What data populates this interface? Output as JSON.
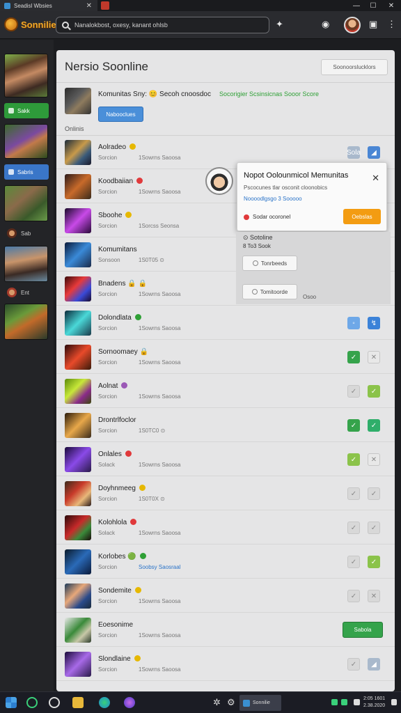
{
  "window": {
    "tab_title": "Seadisl Wbsies",
    "tab_close": "✕",
    "minimize": "—",
    "maximize": "☐",
    "close": "✕"
  },
  "app": {
    "brand": "Sonnilie",
    "search_value": "Nanalokbost, oxesy, kanant ohlsb"
  },
  "rail": {
    "buttons": [
      {
        "label": "Sakk",
        "color": "#2e9a3a"
      },
      {
        "label": "Sabris",
        "color": "#3a76c8"
      }
    ],
    "small_items": [
      {
        "label": "Sab"
      },
      {
        "label": "Ent"
      }
    ]
  },
  "panel": {
    "title": "Nersio Soonline",
    "header_button": "Soonoorslucklors",
    "community_label": "Komunitas Sny: 😊 Secoh cnoosdoc",
    "community_status": "Socorigier Scsinsicnas Sooor Score",
    "community_button": "Nabooclues",
    "online_label": "Onlinis"
  },
  "rows": [
    {
      "name": "Aolradeo",
      "badge": "#e6b800",
      "sub1": "Sorcion",
      "sub2": "1Sowrns Saoosa",
      "c1": "#a9b9cc",
      "c2": "#4a86d4",
      "c1g": "Sola",
      "c2g": "◢"
    },
    {
      "name": "Koodbaiian",
      "badge": "#e0393b",
      "sub1": "Sorcion",
      "sub2": "1Sowrns Saoosa",
      "c1": "",
      "c2": "",
      "c1g": "",
      "c2g": ""
    },
    {
      "name": "Sboohe",
      "badge": "#e6b800",
      "sub1": "Sorcion",
      "sub2": "1Sorcss Seonsa",
      "c1": "",
      "c2": "",
      "c1g": "",
      "c2g": ""
    },
    {
      "name": "Komumitans",
      "badge": "",
      "sub1": "Sonsoon",
      "sub2": "1S0T05 ⊙",
      "c1": "#3b82d8",
      "c2": "#3b82d8",
      "c1g": "↙",
      "c2g": "↯"
    },
    {
      "name": "Bnadens 🔒 🔒",
      "badge": "",
      "sub1": "Sorcion",
      "sub2": "1Sowrns Saoosa",
      "c1": "#e8e8e8",
      "c2": "#35a34b",
      "c1g": "✕",
      "c2g": "✓"
    },
    {
      "name": "Dolondlata",
      "badge": "#2fa036",
      "sub1": "Sorcion",
      "sub2": "1Sowrns Saoosa",
      "c1": "#6ea8e8",
      "c2": "#3b82d8",
      "c1g": "◦",
      "c2g": "↯"
    },
    {
      "name": "Sornoomaey 🔒",
      "badge": "",
      "sub1": "Sorcion",
      "sub2": "1Sowrns Saoosa",
      "c1": "#35a34b",
      "c2": "#e8e8e8",
      "c1g": "✓",
      "c2g": "✕"
    },
    {
      "name": "Aolnat",
      "badge": "#9b59b6",
      "sub1": "Sorcion",
      "sub2": "1Sowrns Saoosa",
      "c1": "#d8d8d8",
      "c2": "#8bc34a",
      "c1g": "✓",
      "c2g": "✓"
    },
    {
      "name": "Drontrlfoclor",
      "badge": "",
      "sub1": "Sorcion",
      "sub2": "1S0TC0 ⊙",
      "c1": "#35a34b",
      "c2": "#2fae6a",
      "c1g": "✓",
      "c2g": "✓"
    },
    {
      "name": "Onlales",
      "badge": "#e0393b",
      "sub1": "Solack",
      "sub2": "1Sowrns Saoosa",
      "c1": "#8bc34a",
      "c2": "#e8e8e8",
      "c1g": "✓",
      "c2g": "✕"
    },
    {
      "name": "Doyhnmeeg",
      "badge": "#e6b800",
      "sub1": "Sorcion",
      "sub2": "1S0T0X ⊙",
      "c1": "#d8d8d8",
      "c2": "#d8d8d8",
      "c1g": "✓",
      "c2g": "✓"
    },
    {
      "name": "Kolohlola",
      "badge": "#e0393b",
      "sub1": "Solack",
      "sub2": "1Sowrns Saoosa",
      "c1": "#d8d8d8",
      "c2": "#d8d8d8",
      "c1g": "✓",
      "c2g": "✓"
    },
    {
      "name": "Korlobes 🟢",
      "badge": "#2fa036",
      "sub1": "Sorcion",
      "sub2": "Soobsy Saosraal",
      "c1": "#d8d8d8",
      "c2": "#8bc34a",
      "c1g": "✓",
      "c2g": "✓"
    },
    {
      "name": "Sondemite",
      "badge": "#e6b800",
      "sub1": "Sorcion",
      "sub2": "1Sowrns Saoosa",
      "c1": "#d8d8d8",
      "c2": "#d8d8d8",
      "c1g": "✓",
      "c2g": "✕"
    },
    {
      "name": "Eoesonime",
      "badge": "",
      "sub1": "Sorcion",
      "sub2": "1Sowrns Saoosa",
      "wide": "Sabola"
    },
    {
      "name": "Slondlaine",
      "badge": "#e6b800",
      "sub1": "Sorcion",
      "sub2": "1Sowrns Saoosa",
      "c1": "#d8d8d8",
      "c2": "#a9b9cc",
      "c1g": "✓",
      "c2g": "◢"
    }
  ],
  "popup": {
    "title": "Nopot Oolounmicol Memunitas",
    "close": "✕",
    "subtitle": "Pscocunes tlar osconit cloonobics",
    "link": "Noooodlgsgo 3 Sooooo",
    "note": "Sodar ocoronel",
    "button": "Oebslas"
  },
  "subpanel": {
    "title": "⊙ Sotoline",
    "count": "8 To3 Sook",
    "button1": "Tonrbeeds",
    "button2": "Tomitoorde",
    "extra": "Osoo"
  },
  "taskbar": {
    "app_label": "Sonnilie",
    "time": "2:05 1601",
    "date": "2.38.2020"
  }
}
